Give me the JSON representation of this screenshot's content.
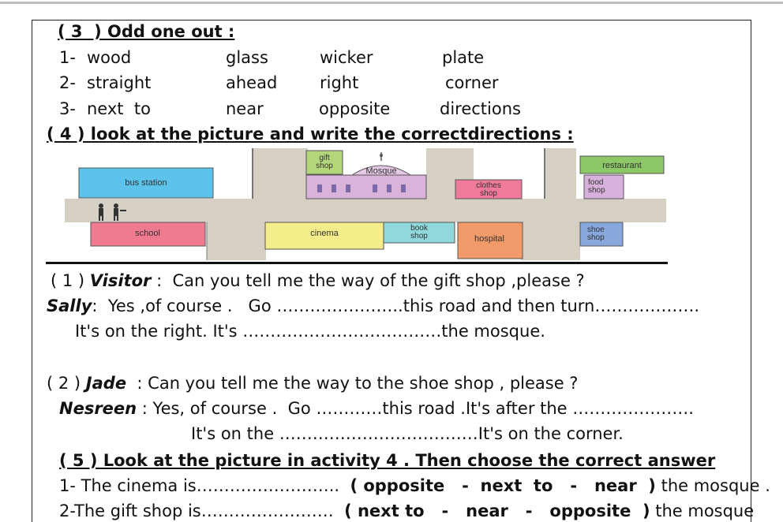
{
  "section3": {
    "title": "( 3  ) Odd one out :",
    "rows": [
      [
        "1-",
        "wood",
        "glass",
        "wicker",
        "plate"
      ],
      [
        "2-",
        "straight",
        "ahead",
        "right",
        "corner"
      ],
      [
        "3-",
        "next  to",
        "near",
        "opposite",
        "directions"
      ]
    ]
  },
  "section4": {
    "title": "( 4 ) look at the picture and write the correctdirections :",
    "map": {
      "bus_station": "bus station",
      "gift_shop_1": "gift",
      "gift_shop_2": "shop",
      "mosque": "Mosque",
      "clothes_shop_1": "clothes",
      "clothes_shop_2": "shop",
      "restaurant": "restaurant",
      "food_shop_1": "food",
      "food_shop_2": "shop",
      "school": "school",
      "cinema": "cinema",
      "book_shop_1": "book",
      "book_shop_2": "shop",
      "hospital": "hospital",
      "shoe_shop_1": "shoe",
      "shoe_shop_2": "shop",
      "colors": {
        "bus_station": "#5bc3ec",
        "gift_shop": "#b4d67a",
        "mosque": "#d9b3d9",
        "clothes_shop": "#f07a9a",
        "restaurant": "#8cc866",
        "food_shop": "#d7b0db",
        "school": "#f07a90",
        "cinema": "#f5ec8a",
        "book_shop": "#8fd8dc",
        "hospital": "#f29a6a",
        "shoe_shop": "#88a7dc",
        "road": "#d6d0c4"
      }
    },
    "dialogue1": {
      "num": "( 1 )",
      "speaker1": "Visitor",
      "line1": " :  Can you tell me the way of the gift shop ,please ?",
      "speaker2": "Sally",
      "line2": ":  Yes ,of course .   Go …………………..this road and then turn……………….",
      "line3": "It's on the right. It's ………………………………the mosque."
    },
    "dialogue2": {
      "num": "( 2 )",
      "speaker1": "Jade",
      "line1": "  : Can you tell me the way to the shoe shop , please ?",
      "speaker2": "Nesreen",
      "line2": " : Yes, of course .  Go …………this road .It's after the ………………….",
      "line3": "It's on the ………………………………It's on the corner."
    }
  },
  "section5": {
    "title": "( 5 ) Look at the picture in activity 4 . Then choose the correct answer",
    "q1": {
      "prefix": "1- The cinema is……………………..  ",
      "options": "( opposite   -  next  to   -   near  )",
      "suffix": " the mosque ."
    },
    "q2": {
      "prefix": "2-The gift shop is……………………  ",
      "options": "( next to   -   near   -   opposite  )",
      "suffix": " the mosque"
    }
  }
}
